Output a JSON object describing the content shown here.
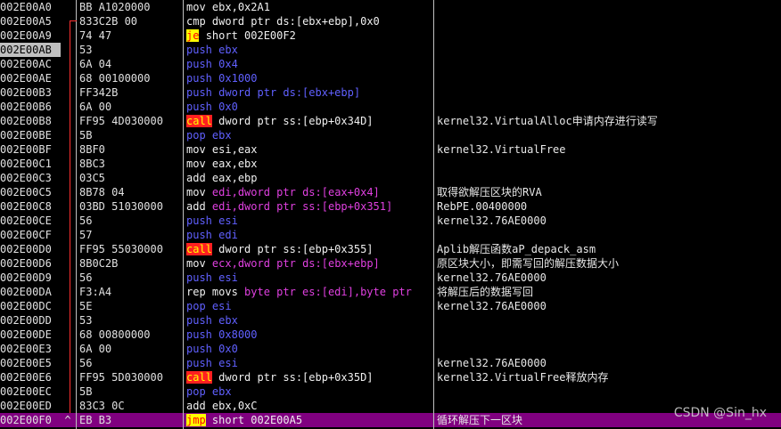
{
  "rows": [
    {
      "addr": "002E00A0",
      "mark": "",
      "hex": "BB A1020000",
      "mnem": "mov",
      "op": "ebx,0x2A1",
      "kind": "mov",
      "cmt": ""
    },
    {
      "addr": "002E00A5",
      "mark": "",
      "hex": "833C2B 00",
      "mnem": "cmp",
      "op": "dword ptr ds:[ebx+ebp],0x0",
      "kind": "cmp",
      "cmt": ""
    },
    {
      "addr": "002E00A9",
      "mark": "",
      "hex": "74 47",
      "mnem": "je",
      "op": "short 002E00F2",
      "kind": "jcc",
      "cmt": ""
    },
    {
      "addr": "002E00AB",
      "mark": "",
      "hex": "53",
      "mnem": "push",
      "op": "ebx",
      "kind": "push",
      "cmt": "",
      "addr_hl": true
    },
    {
      "addr": "002E00AC",
      "mark": "",
      "hex": "6A 04",
      "mnem": "push",
      "op": "0x4",
      "kind": "push",
      "cmt": ""
    },
    {
      "addr": "002E00AE",
      "mark": "",
      "hex": "68 00100000",
      "mnem": "push",
      "op": "0x1000",
      "kind": "push",
      "cmt": ""
    },
    {
      "addr": "002E00B3",
      "mark": "",
      "hex": "FF342B",
      "mnem": "push",
      "op": "dword ptr ds:[ebx+ebp]",
      "kind": "push",
      "cmt": ""
    },
    {
      "addr": "002E00B6",
      "mark": "",
      "hex": "6A 00",
      "mnem": "push",
      "op": "0x0",
      "kind": "push",
      "cmt": ""
    },
    {
      "addr": "002E00B8",
      "mark": "",
      "hex": "FF95 4D030000",
      "mnem": "call",
      "op": "dword ptr ss:[ebp+0x34D]",
      "kind": "call",
      "cmt": "kernel32.VirtualAlloc申请内存进行读写"
    },
    {
      "addr": "002E00BE",
      "mark": "",
      "hex": "5B",
      "mnem": "pop",
      "op": "ebx",
      "kind": "pop",
      "cmt": ""
    },
    {
      "addr": "002E00BF",
      "mark": "",
      "hex": "8BF0",
      "mnem": "mov",
      "op": "esi,eax",
      "kind": "mov",
      "cmt": "kernel32.VirtualFree"
    },
    {
      "addr": "002E00C1",
      "mark": "",
      "hex": "8BC3",
      "mnem": "mov",
      "op": "eax,ebx",
      "kind": "mov",
      "cmt": ""
    },
    {
      "addr": "002E00C3",
      "mark": "",
      "hex": "03C5",
      "mnem": "add",
      "op": "eax,ebp",
      "kind": "mov",
      "cmt": ""
    },
    {
      "addr": "002E00C5",
      "mark": "",
      "hex": "8B78 04",
      "mnem": "mov",
      "op": "edi,dword ptr ds:[eax+0x4]",
      "kind": "mem",
      "cmt": "取得欲解压区块的RVA"
    },
    {
      "addr": "002E00C8",
      "mark": "",
      "hex": "03BD 51030000",
      "mnem": "add",
      "op": "edi,dword ptr ss:[ebp+0x351]",
      "kind": "mem",
      "cmt": "RebPE.00400000"
    },
    {
      "addr": "002E00CE",
      "mark": "",
      "hex": "56",
      "mnem": "push",
      "op": "esi",
      "kind": "push",
      "cmt": "kernel32.76AE0000"
    },
    {
      "addr": "002E00CF",
      "mark": "",
      "hex": "57",
      "mnem": "push",
      "op": "edi",
      "kind": "push",
      "cmt": ""
    },
    {
      "addr": "002E00D0",
      "mark": "",
      "hex": "FF95 55030000",
      "mnem": "call",
      "op": "dword ptr ss:[ebp+0x355]",
      "kind": "call",
      "cmt": "Aplib解压函数aP_depack_asm"
    },
    {
      "addr": "002E00D6",
      "mark": "",
      "hex": "8B0C2B",
      "mnem": "mov",
      "op": "ecx,dword ptr ds:[ebx+ebp]",
      "kind": "mem",
      "cmt": "原区块大小，即需写回的解压数据大小"
    },
    {
      "addr": "002E00D9",
      "mark": "",
      "hex": "56",
      "mnem": "push",
      "op": "esi",
      "kind": "push",
      "cmt": "kernel32.76AE0000"
    },
    {
      "addr": "002E00DA",
      "mark": "",
      "hex": "F3:A4",
      "mnem": "rep movs",
      "op": "byte ptr es:[edi],byte ptr",
      "kind": "rep",
      "cmt": "将解压后的数据写回"
    },
    {
      "addr": "002E00DC",
      "mark": "",
      "hex": "5E",
      "mnem": "pop",
      "op": "esi",
      "kind": "pop",
      "cmt": "kernel32.76AE0000"
    },
    {
      "addr": "002E00DD",
      "mark": "",
      "hex": "53",
      "mnem": "push",
      "op": "ebx",
      "kind": "push",
      "cmt": ""
    },
    {
      "addr": "002E00DE",
      "mark": "",
      "hex": "68 00800000",
      "mnem": "push",
      "op": "0x8000",
      "kind": "push",
      "cmt": ""
    },
    {
      "addr": "002E00E3",
      "mark": "",
      "hex": "6A 00",
      "mnem": "push",
      "op": "0x0",
      "kind": "push",
      "cmt": ""
    },
    {
      "addr": "002E00E5",
      "mark": "",
      "hex": "56",
      "mnem": "push",
      "op": "esi",
      "kind": "push",
      "cmt": "kernel32.76AE0000"
    },
    {
      "addr": "002E00E6",
      "mark": "",
      "hex": "FF95 5D030000",
      "mnem": "call",
      "op": "dword ptr ss:[ebp+0x35D]",
      "kind": "call",
      "cmt": "kernel32.VirtualFree释放内存"
    },
    {
      "addr": "002E00EC",
      "mark": "",
      "hex": "5B",
      "mnem": "pop",
      "op": "ebx",
      "kind": "pop",
      "cmt": ""
    },
    {
      "addr": "002E00ED",
      "mark": "",
      "hex": "83C3 0C",
      "mnem": "add",
      "op": "ebx,0xC",
      "kind": "mov",
      "cmt": ""
    },
    {
      "addr": "002E00F0",
      "mark": "^",
      "hex": "EB B3",
      "mnem": "jmp",
      "op": "short 002E00A5",
      "kind": "jmp",
      "cmt": "循环解压下一区块",
      "selected": true
    }
  ],
  "watermark": "CSDN @Sin_hx",
  "colors": {
    "background": "#000000",
    "selected_row": "#800080",
    "push_pop": "#6060ff",
    "memory_operand": "#e040e0",
    "call_bg": "#ff2020",
    "jump_bg": "#ffff00",
    "jump_line": "#ff3030"
  }
}
